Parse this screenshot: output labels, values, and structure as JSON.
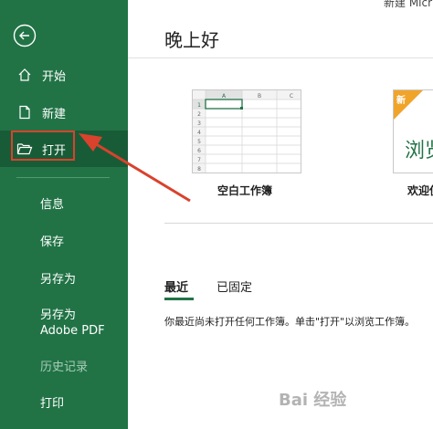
{
  "window": {
    "title_partial": "新建 Micr"
  },
  "sidebar": {
    "items": [
      {
        "label": "开始",
        "icon": "home-icon"
      },
      {
        "label": "新建",
        "icon": "new-document-icon"
      },
      {
        "label": "打开",
        "icon": "open-folder-icon",
        "selected": true
      },
      {
        "label": "信息"
      },
      {
        "label": "保存"
      },
      {
        "label": "另存为"
      },
      {
        "label": "另存为 Adobe PDF"
      },
      {
        "label": "历史记录",
        "disabled": true
      },
      {
        "label": "打印"
      }
    ],
    "back_icon": "back-arrow-icon",
    "color": "#217346",
    "selected_color": "#185c37"
  },
  "main": {
    "greeting": "晚上好",
    "templates": [
      {
        "label": "空白工作簿",
        "columns": [
          "A",
          "B",
          "C"
        ],
        "rows": [
          "1",
          "2",
          "3",
          "4",
          "5",
          "6",
          "7",
          "8"
        ]
      },
      {
        "label": "欢迎使",
        "badge": "新",
        "preview_text": "浏览"
      }
    ],
    "tabs": [
      {
        "label": "最近",
        "active": true
      },
      {
        "label": "已固定"
      }
    ],
    "empty_message": "你最近尚未打开任何工作簿。单击\"打开\"以浏览工作簿。"
  },
  "watermark": "Bai 经验",
  "annotation_color": "#d9422d"
}
